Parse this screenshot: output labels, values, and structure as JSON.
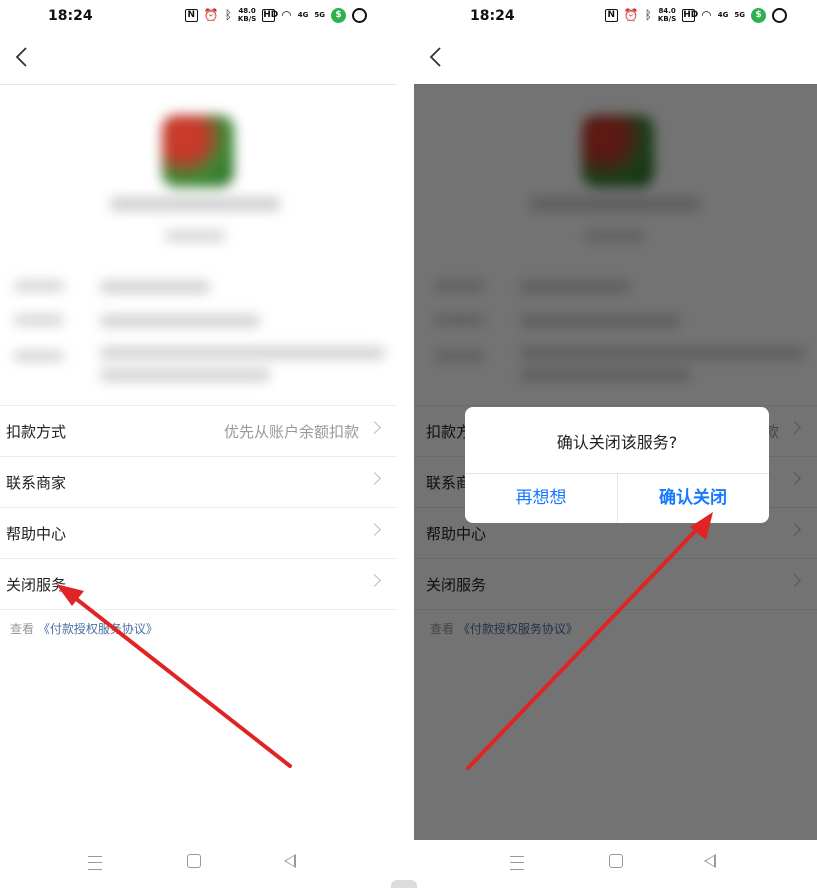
{
  "status_bar": {
    "time": "18:24",
    "left_speed": "48.0",
    "right_speed": "84.0",
    "speed_unit": "KB/S",
    "hd_label": "HD",
    "net1": "4G",
    "net2": "5G"
  },
  "menu": {
    "items": [
      {
        "label": "扣款方式",
        "value": "优先从账户余额扣款"
      },
      {
        "label": "联系商家",
        "value": ""
      },
      {
        "label": "帮助中心",
        "value": ""
      },
      {
        "label": "关闭服务",
        "value": ""
      }
    ]
  },
  "agreement": {
    "prefix": "查看",
    "link": "《付款授权服务协议》"
  },
  "dialog": {
    "title": "确认关闭该服务?",
    "cancel_label": "再想想",
    "confirm_label": "确认关闭"
  },
  "colors": {
    "accent": "#1677ff",
    "annotation_arrow": "#e02424",
    "overlay": "#000000",
    "status_green": "#2bb24c"
  },
  "icons": {
    "back": "chevron-left-icon",
    "nfc": "nfc-icon",
    "alarm": "alarm-icon",
    "bluetooth": "bluetooth-icon",
    "wifi": "wifi-icon",
    "signal": "signal-icon",
    "shield": "shield-icon",
    "nav_menu": "menu-icon",
    "nav_home": "home-icon",
    "nav_back": "back-triangle-icon"
  }
}
